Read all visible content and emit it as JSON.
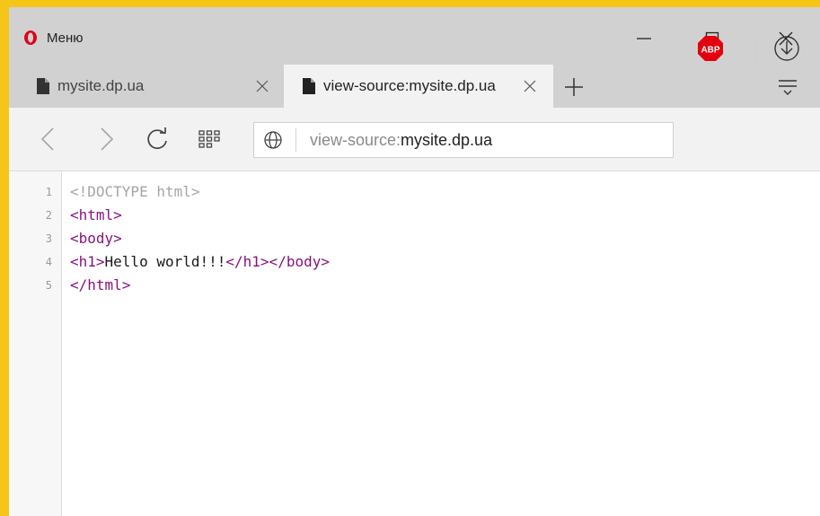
{
  "browser": {
    "menu_label": "Меню",
    "colors": {
      "frame": "#f5c518",
      "titlebar": "#d1d1d1",
      "active_tab": "#f2f2f2",
      "opera_red": "#e0001b",
      "abp_red": "#e3000f",
      "tag_purple": "#881280"
    }
  },
  "tabs": [
    {
      "title": "mysite.dp.ua",
      "icon": "document-icon"
    },
    {
      "title": "view-source:mysite.dp.ua",
      "icon": "document-icon",
      "active": true
    }
  ],
  "toolbar": {
    "address_prefix": "view-source:",
    "address_host": "mysite.dp.ua",
    "abp_label": "ABP"
  },
  "source": {
    "lines": [
      {
        "number": "1",
        "text": "<!DOCTYPE html>"
      },
      {
        "number": "2",
        "text": "<html>"
      },
      {
        "number": "3",
        "text": "<body>"
      },
      {
        "number": "4",
        "open_tag": "<h1>",
        "content": "Hello world!!!",
        "close_tags": "</h1></body>"
      },
      {
        "number": "5",
        "text": "</html>"
      }
    ]
  }
}
